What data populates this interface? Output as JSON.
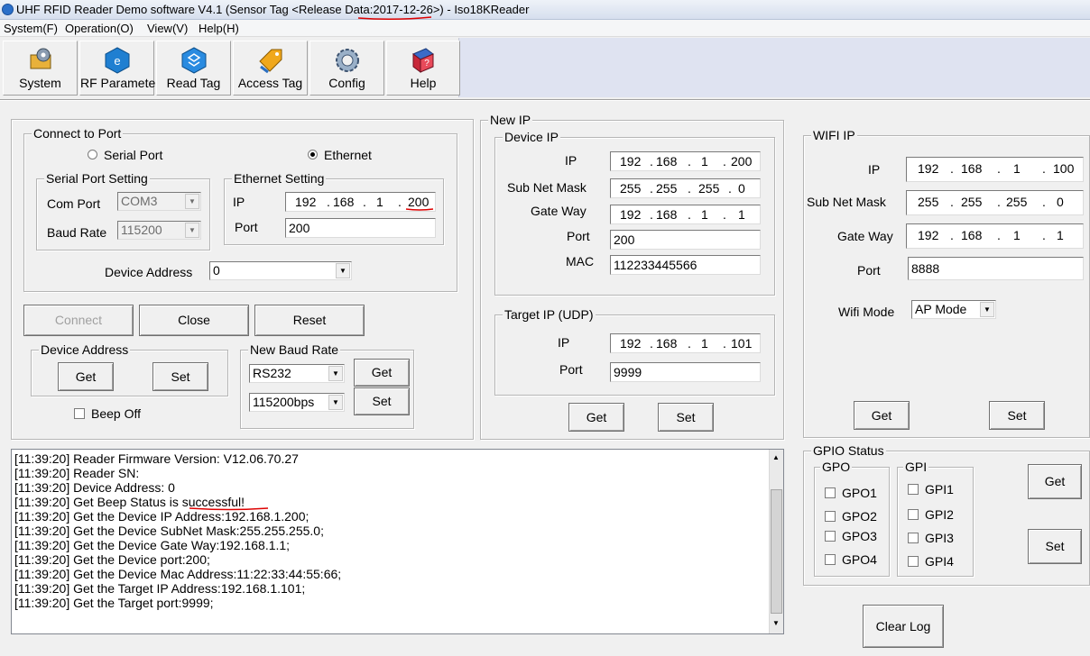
{
  "window": {
    "title": "UHF RFID Reader Demo software V4.1 (Sensor Tag <Release Data:2017-12-26>) - Iso18KReader"
  },
  "menu": [
    "System(F)",
    "Operation(O)",
    "View(V)",
    "Help(H)"
  ],
  "toolbar": [
    "System",
    "RF Parameter",
    "Read Tag",
    "Access Tag",
    "Config",
    "Help"
  ],
  "connect": {
    "title": "Connect to Port",
    "serial_label": "Serial Port",
    "ethernet_label": "Ethernet",
    "selected": "Ethernet",
    "serial_setting": {
      "title": "Serial Port Setting",
      "com_label": "Com Port",
      "com_value": "COM3",
      "baud_label": "Baud Rate",
      "baud_value": "115200"
    },
    "ethernet_setting": {
      "title": "Ethernet Setting",
      "ip_label": "IP",
      "ip": [
        "192",
        "168",
        "1",
        "200"
      ],
      "port_label": "Port",
      "port": "200"
    },
    "device_address_label": "Device Address",
    "device_address": "0"
  },
  "actions": {
    "connect": "Connect",
    "close": "Close",
    "reset": "Reset"
  },
  "device_address_group": {
    "title": "Device Address",
    "get": "Get",
    "set": "Set"
  },
  "baud_group": {
    "title": "New Baud Rate",
    "mode": "RS232",
    "rate": "115200bps",
    "get": "Get",
    "set": "Set"
  },
  "beep_off": "Beep Off",
  "new_ip": {
    "title": "New IP",
    "device_ip": {
      "title": "Device IP",
      "ip_label": "IP",
      "ip": [
        "192",
        "168",
        "1",
        "200"
      ],
      "mask_label": "Sub Net Mask",
      "mask": [
        "255",
        "255",
        "255",
        "0"
      ],
      "gateway_label": "Gate Way",
      "gateway": [
        "192",
        "168",
        "1",
        "1"
      ],
      "port_label": "Port",
      "port": "200",
      "mac_label": "MAC",
      "mac": "112233445566"
    },
    "target_ip": {
      "title": "Target IP (UDP)",
      "ip_label": "IP",
      "ip": [
        "192",
        "168",
        "1",
        "101"
      ],
      "port_label": "Port",
      "port": "9999"
    },
    "get": "Get",
    "set": "Set"
  },
  "wifi": {
    "title": "WIFI IP",
    "ip_label": "IP",
    "ip": [
      "192",
      "168",
      "1",
      "100"
    ],
    "mask_label": "Sub Net Mask",
    "mask": [
      "255",
      "255",
      "255",
      "0"
    ],
    "gateway_label": "Gate Way",
    "gateway": [
      "192",
      "168",
      "1",
      "1"
    ],
    "port_label": "Port",
    "port": "8888",
    "mode_label": "Wifi Mode",
    "mode": "AP Mode",
    "get": "Get",
    "set": "Set"
  },
  "gpio": {
    "title": "GPIO Status",
    "gpo_title": "GPO",
    "gpo": [
      "GPO1",
      "GPO2",
      "GPO3",
      "GPO4"
    ],
    "gpi_title": "GPI",
    "gpi": [
      "GPI1",
      "GPI2",
      "GPI3",
      "GPI4"
    ],
    "get": "Get",
    "set": "Set"
  },
  "clear_log": "Clear Log",
  "log": [
    "[11:39:20] Reader Firmware Version: V12.06.70.27",
    "[11:39:20] Reader SN:",
    "[11:39:20] Device Address: 0",
    "[11:39:20] Get Beep Status is successful!",
    "[11:39:20] Get the Device IP Address:192.168.1.200;",
    "[11:39:20] Get the Device SubNet Mask:255.255.255.0;",
    "[11:39:20] Get the Device Gate Way:192.168.1.1;",
    "[11:39:20] Get the Device port:200;",
    "[11:39:20] Get the Device Mac Address:11:22:33:44:55:66;",
    "[11:39:20] Get the Target IP Address:192.168.1.101;",
    "[11:39:20] Get the Target port:9999;"
  ]
}
